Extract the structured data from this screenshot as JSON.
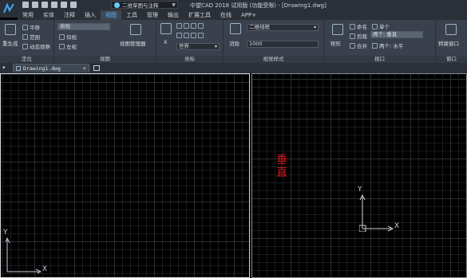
{
  "titlebar": {
    "workspace": "二维草图与注释",
    "title": "中望CAD 2018 试用版 (功能受限) - [Drawing1.dwg]"
  },
  "menu": {
    "tabs": [
      "常用",
      "实体",
      "注释",
      "插入",
      "视图",
      "工具",
      "管理",
      "输出",
      "扩展工具",
      "在线",
      "APP+"
    ],
    "active": "视图"
  },
  "ribbon": {
    "nav": {
      "label": "定位",
      "regen": "重生成",
      "pan": "平移",
      "range": "范围",
      "orbit": "动态观察"
    },
    "views": {
      "label": "视图",
      "top": "俯视",
      "front": "仰视",
      "left": "左视",
      "manager": "视图管理器"
    },
    "coords": {
      "label": "坐标",
      "x": "X",
      "world": "世界"
    },
    "visual": {
      "label": "视觉样式",
      "shade": "消隐",
      "style": "二维线框",
      "value": "1000"
    },
    "viewports": {
      "label": "视口",
      "rect": "矩形",
      "name": "命名",
      "clip": "剪裁",
      "merge": "合并",
      "single": "单个",
      "two_a": "两个:",
      "two_a_val": "垂直",
      "two_b": "两个:",
      "two_b_val": "水平"
    },
    "windows": {
      "label": "窗口",
      "switch": "转换窗口"
    }
  },
  "document": {
    "tab": "Drawing1.dwg"
  },
  "viewport_left": {
    "x_label": "X",
    "y_label": "Y"
  },
  "viewport_right": {
    "x_label": "X",
    "y_label": "Y",
    "annotation": "垂直"
  }
}
